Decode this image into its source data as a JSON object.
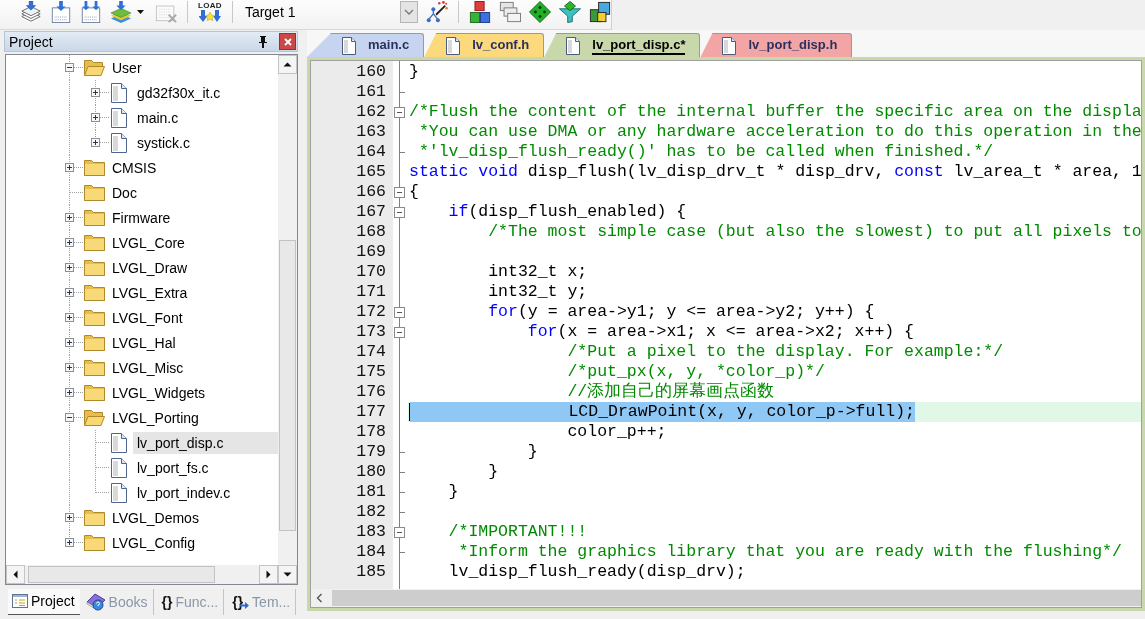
{
  "toolbar": {
    "groups": [
      {
        "buttons": [
          {
            "kind": "translate",
            "disabled": false
          },
          {
            "kind": "build",
            "disabled": false
          },
          {
            "kind": "rebuild",
            "disabled": false
          },
          {
            "kind": "batch",
            "disabled": false
          },
          {
            "kind": "stop",
            "disabled": true
          }
        ]
      },
      {
        "buttons": [
          {
            "kind": "download",
            "label": "LOAD",
            "disabled": false
          }
        ]
      },
      {
        "target": "Target 1",
        "buttons": [
          {
            "kind": "options",
            "disabled": false
          }
        ]
      },
      {
        "buttons": [
          {
            "kind": "components",
            "disabled": false
          },
          {
            "kind": "multiproject",
            "disabled": false
          },
          {
            "kind": "packs",
            "disabled": false
          },
          {
            "kind": "filter",
            "disabled": false
          },
          {
            "kind": "environment",
            "disabled": false
          }
        ]
      }
    ]
  },
  "project_panel": {
    "title": "Project",
    "tree": [
      {
        "label": "User",
        "kind": "folder",
        "expanded": true,
        "selected": false,
        "children": [
          {
            "label": "gd32f30x_it.c",
            "kind": "file",
            "expanded": false,
            "selected": false
          },
          {
            "label": "main.c",
            "kind": "file",
            "expanded": false,
            "selected": false
          },
          {
            "label": "systick.c",
            "kind": "file",
            "expanded": false,
            "selected": false
          }
        ]
      },
      {
        "label": "CMSIS",
        "kind": "folder",
        "expanded": false,
        "selected": false
      },
      {
        "label": "Doc",
        "kind": "folder",
        "selected": false
      },
      {
        "label": "Firmware",
        "kind": "folder",
        "expanded": false,
        "selected": false
      },
      {
        "label": "LVGL_Core",
        "kind": "folder",
        "expanded": false,
        "selected": false
      },
      {
        "label": "LVGL_Draw",
        "kind": "folder",
        "expanded": false,
        "selected": false
      },
      {
        "label": "LVGL_Extra",
        "kind": "folder",
        "expanded": false,
        "selected": false
      },
      {
        "label": "LVGL_Font",
        "kind": "folder",
        "expanded": false,
        "selected": false
      },
      {
        "label": "LVGL_Hal",
        "kind": "folder",
        "expanded": false,
        "selected": false
      },
      {
        "label": "LVGL_Misc",
        "kind": "folder",
        "expanded": false,
        "selected": false
      },
      {
        "label": "LVGL_Widgets",
        "kind": "folder",
        "expanded": false,
        "selected": false
      },
      {
        "label": "LVGL_Porting",
        "kind": "folder",
        "expanded": true,
        "selected": false,
        "children": [
          {
            "label": "lv_port_disp.c",
            "kind": "file",
            "selected": true
          },
          {
            "label": "lv_port_fs.c",
            "kind": "file",
            "selected": false
          },
          {
            "label": "lv_port_indev.c",
            "kind": "file",
            "selected": false
          }
        ]
      },
      {
        "label": "LVGL_Demos",
        "kind": "folder",
        "expanded": false,
        "selected": false
      },
      {
        "label": "LVGL_Config",
        "kind": "folder",
        "expanded": false,
        "selected": false
      }
    ],
    "tabs": [
      {
        "label": "Project",
        "kind": "project",
        "selected": true
      },
      {
        "label": "Books",
        "kind": "books",
        "selected": false
      },
      {
        "label": "Func...",
        "kind": "functions",
        "glyph": "{}",
        "selected": false
      },
      {
        "label": "Tem...",
        "kind": "templates",
        "glyph": "{}",
        "selected": false
      }
    ]
  },
  "editor": {
    "tabs": [
      {
        "label": "main.c",
        "color": "#c7d4ef",
        "selected": false
      },
      {
        "label": "lv_conf.h",
        "color": "#fbd97c",
        "selected": false
      },
      {
        "label": "lv_port_disp.c*",
        "color": "#c9d8ab",
        "selected": true
      },
      {
        "label": "lv_port_disp.h",
        "color": "#f3a5a5",
        "selected": false
      }
    ],
    "lines": [
      {
        "number": "160",
        "kind": "plain",
        "selected": false,
        "segments": [
          {
            "kind": "plain",
            "text": "}"
          }
        ]
      },
      {
        "number": "161",
        "kind": "end",
        "selected": false
      },
      {
        "number": "162",
        "kind": "fold",
        "expanded": true,
        "selected": false,
        "segments": [
          {
            "kind": "comment",
            "text": "/*Flush the content of the internal buffer the specific area on the displa"
          }
        ]
      },
      {
        "number": "163",
        "kind": "plain",
        "selected": false,
        "segments": [
          {
            "kind": "comment",
            "text": " *You can use DMA or any hardware acceleration to do this operation in the"
          }
        ]
      },
      {
        "number": "164",
        "kind": "end",
        "selected": false,
        "segments": [
          {
            "kind": "comment",
            "text": " *'lv_disp_flush_ready()' has to be called when finished.*/"
          }
        ]
      },
      {
        "number": "165",
        "kind": "plain",
        "selected": false,
        "segments": [
          {
            "kind": "keyword",
            "text": "static"
          },
          {
            "kind": "keyword",
            "text": " void"
          },
          {
            "kind": "plain",
            "text": " disp_flush(lv_disp_drv_t * disp_drv, "
          },
          {
            "kind": "keyword",
            "text": "const"
          },
          {
            "kind": "plain",
            "text": " lv_area_t * area, 1"
          }
        ]
      },
      {
        "number": "166",
        "kind": "fold",
        "expanded": true,
        "selected": false,
        "segments": [
          {
            "kind": "plain",
            "text": "{"
          }
        ]
      },
      {
        "number": "167",
        "kind": "fold",
        "expanded": true,
        "selected": false,
        "segments": [
          {
            "kind": "keyword",
            "text": "    if"
          },
          {
            "kind": "plain",
            "text": "(disp_flush_enabled) {"
          }
        ]
      },
      {
        "number": "168",
        "kind": "plain",
        "selected": false,
        "segments": [
          {
            "kind": "comment",
            "text": "        /*The most simple case (but also the slowest) to put all pixels to"
          }
        ]
      },
      {
        "number": "169",
        "kind": "plain",
        "selected": false
      },
      {
        "number": "170",
        "kind": "plain",
        "selected": false,
        "segments": [
          {
            "kind": "plain",
            "text": "        int32_t x;"
          }
        ]
      },
      {
        "number": "171",
        "kind": "plain",
        "selected": false,
        "segments": [
          {
            "kind": "plain",
            "text": "        int32_t y;"
          }
        ]
      },
      {
        "number": "172",
        "kind": "fold",
        "expanded": true,
        "selected": false,
        "segments": [
          {
            "kind": "keyword",
            "text": "        for"
          },
          {
            "kind": "plain",
            "text": "(y = area->y1; y <= area->y2; y++) {"
          }
        ]
      },
      {
        "number": "173",
        "kind": "fold",
        "expanded": true,
        "selected": false,
        "segments": [
          {
            "kind": "keyword",
            "text": "            for"
          },
          {
            "kind": "plain",
            "text": "(x = area->x1; x <= area->x2; x++) {"
          }
        ]
      },
      {
        "number": "174",
        "kind": "plain",
        "selected": false,
        "segments": [
          {
            "kind": "comment",
            "text": "                /*Put a pixel to the display. For example:*/"
          }
        ]
      },
      {
        "number": "175",
        "kind": "plain",
        "selected": false,
        "segments": [
          {
            "kind": "comment",
            "text": "                /*put_px(x, y, *color_p)*/"
          }
        ]
      },
      {
        "number": "176",
        "kind": "plain",
        "selected": false,
        "segments": [
          {
            "kind": "comment",
            "text": "                //添加自己的屏幕画点函数"
          }
        ]
      },
      {
        "number": "177",
        "kind": "plain",
        "selected": true,
        "segments": [
          {
            "kind": "plain",
            "text": "                LCD_DrawPoint(x, y, color_p->full);"
          }
        ]
      },
      {
        "number": "178",
        "kind": "plain",
        "selected": false,
        "segments": [
          {
            "kind": "plain",
            "text": "                color_p++;"
          }
        ]
      },
      {
        "number": "179",
        "kind": "end",
        "selected": false,
        "segments": [
          {
            "kind": "plain",
            "text": "            }"
          }
        ]
      },
      {
        "number": "180",
        "kind": "end",
        "selected": false,
        "segments": [
          {
            "kind": "plain",
            "text": "        }"
          }
        ]
      },
      {
        "number": "181",
        "kind": "end",
        "selected": false,
        "segments": [
          {
            "kind": "plain",
            "text": "    }"
          }
        ]
      },
      {
        "number": "182",
        "kind": "end",
        "selected": false
      },
      {
        "number": "183",
        "kind": "fold",
        "expanded": true,
        "selected": false,
        "segments": [
          {
            "kind": "comment",
            "text": "    /*IMPORTANT!!!"
          }
        ]
      },
      {
        "number": "184",
        "kind": "end",
        "selected": false,
        "segments": [
          {
            "kind": "comment",
            "text": "     *Inform the graphics library that you are ready with the flushing*/"
          }
        ]
      },
      {
        "number": "185",
        "kind": "plain",
        "selected": false,
        "segments": [
          {
            "kind": "plain",
            "text": "    lv_disp_flush_ready(disp_drv);"
          }
        ]
      }
    ]
  }
}
